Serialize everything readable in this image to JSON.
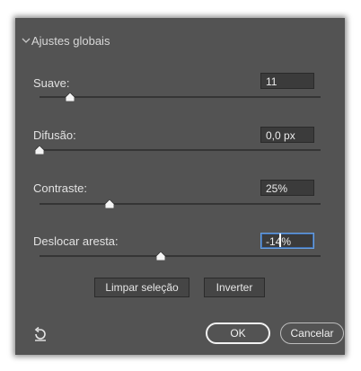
{
  "section": {
    "title": "Ajustes globais"
  },
  "sliders": [
    {
      "label": "Suave:",
      "value": "11",
      "level": 0.11
    },
    {
      "label": "Difusão:",
      "value": "0,0 px",
      "level": 0.0
    },
    {
      "label": "Contraste:",
      "value": "25%",
      "level": 0.25
    },
    {
      "label": "Deslocar aresta:",
      "value": "-14%",
      "level": 0.43
    }
  ],
  "buttons": {
    "clear": "Limpar seleção",
    "invert": "Inverter"
  },
  "footer": {
    "ok": "OK",
    "cancel": "Cancelar"
  },
  "icons": {
    "collapse": "chevron-down-icon",
    "reset": "reset-icon",
    "thumb": "slider-thumb-icon"
  },
  "colors": {
    "panel": "#535353",
    "field": "#3b3b3b",
    "focus": "#6aa0e0"
  }
}
